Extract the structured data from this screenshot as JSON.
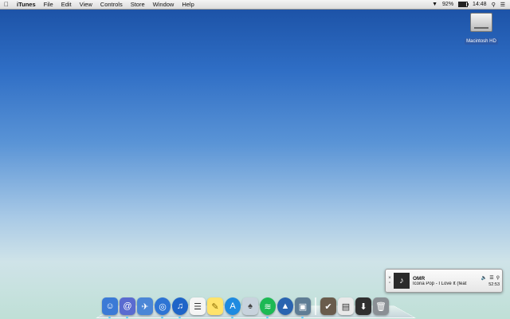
{
  "menubar": {
    "apple_icon": "apple-icon",
    "items": [
      "iTunes",
      "File",
      "Edit",
      "View",
      "Controls",
      "Store",
      "Window",
      "Help"
    ],
    "battery_percent": "92%",
    "battery_level": 0.92,
    "time": "14:48"
  },
  "desktop": {
    "hd_label": "Macintosh HD"
  },
  "mini_player": {
    "title": "OMR",
    "subtitle": "Icona Pop - I Love It (feat",
    "time": "52:53"
  },
  "dock": {
    "apps": [
      {
        "name": "finder"
      },
      {
        "name": "contacts"
      },
      {
        "name": "mail"
      },
      {
        "name": "safari"
      },
      {
        "name": "itunes"
      },
      {
        "name": "reminders"
      },
      {
        "name": "stickies"
      },
      {
        "name": "app-store"
      },
      {
        "name": "atlas"
      },
      {
        "name": "spotify"
      },
      {
        "name": "rocket"
      },
      {
        "name": "preview"
      }
    ],
    "right_items": [
      {
        "name": "trash"
      }
    ]
  },
  "colors": {
    "menubar": "#e8e8e8",
    "desktop_top": "#1a4fa3",
    "desktop_bottom": "#bfe0d6"
  }
}
